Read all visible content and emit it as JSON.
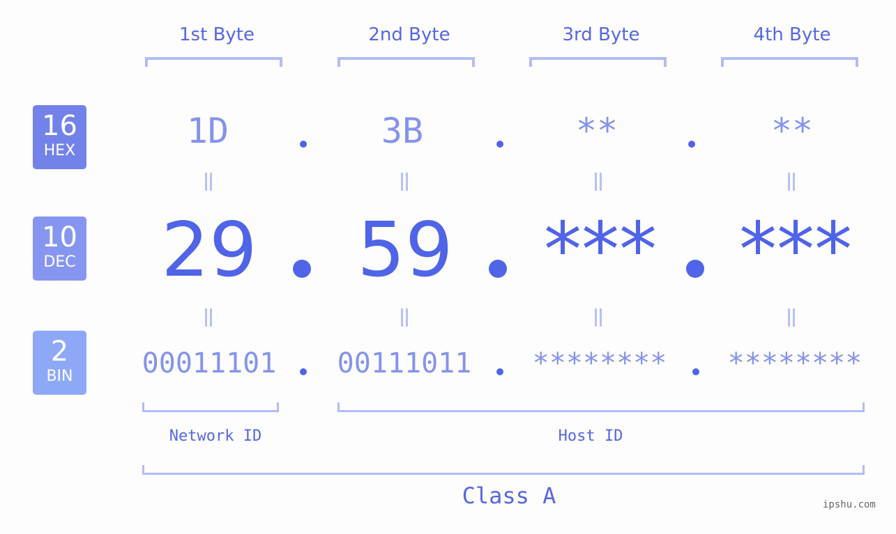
{
  "badges": [
    {
      "num": "16",
      "label": "HEX",
      "color": "#7282e9"
    },
    {
      "num": "10",
      "label": "DEC",
      "color": "#8696f0"
    },
    {
      "num": "2",
      "label": "BIN",
      "color": "#8da8f7"
    }
  ],
  "bytes": [
    {
      "header": "1st Byte",
      "hex": "1D",
      "dec": "29",
      "bin": "00011101"
    },
    {
      "header": "2nd Byte",
      "hex": "3B",
      "dec": "59",
      "bin": "00111011"
    },
    {
      "header": "3rd Byte",
      "hex": "**",
      "dec": "***",
      "bin": "********"
    },
    {
      "header": "4th Byte",
      "hex": "**",
      "dec": "***",
      "bin": "********"
    }
  ],
  "labels": {
    "network": "Network ID",
    "host": "Host ID",
    "class": "Class A"
  },
  "watermark": "ipshu.com",
  "colors": {
    "accent": "#5064e8",
    "light": "#8593ec",
    "bracket": "#b1bcf6"
  }
}
